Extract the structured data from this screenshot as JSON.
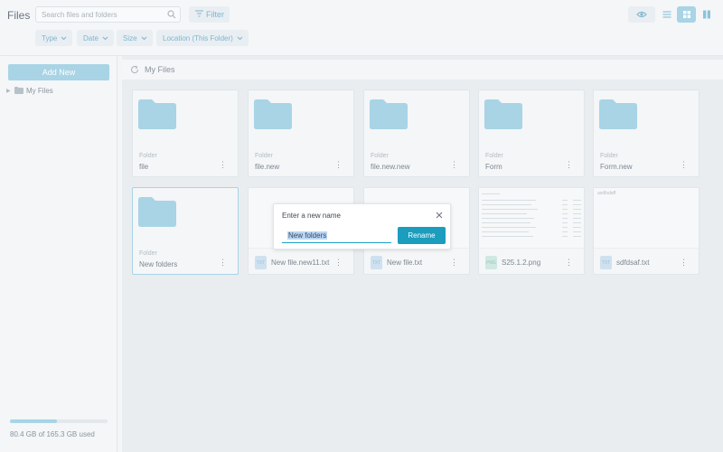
{
  "app": {
    "title": "Files"
  },
  "search": {
    "placeholder": "Search files and folders"
  },
  "toolbar": {
    "filter_label": "Filter"
  },
  "filters": [
    {
      "label": "Type"
    },
    {
      "label": "Date"
    },
    {
      "label": "Size"
    },
    {
      "label": "Location (This Folder)"
    }
  ],
  "view_buttons": [
    {
      "icon": "eye-icon"
    },
    {
      "icon": "list-view-icon"
    },
    {
      "icon": "grid-view-icon",
      "active": true
    },
    {
      "icon": "column-view-icon"
    }
  ],
  "sidebar": {
    "add_new_label": "Add New",
    "tree": [
      {
        "label": "My Files",
        "icon": "folder-icon"
      }
    ],
    "storage": {
      "used_fraction": 0.486,
      "text": "80.4 GB of 165.3 GB used"
    }
  },
  "breadcrumb": {
    "label": "My Files"
  },
  "items": [
    {
      "kind": "folder",
      "type_label": "Folder",
      "name": "file"
    },
    {
      "kind": "folder",
      "type_label": "Folder",
      "name": "file.new"
    },
    {
      "kind": "folder",
      "type_label": "Folder",
      "name": "file.new.new"
    },
    {
      "kind": "folder",
      "type_label": "Folder",
      "name": "Form"
    },
    {
      "kind": "folder",
      "type_label": "Folder",
      "name": "Form.new"
    },
    {
      "kind": "folder",
      "type_label": "Folder",
      "name": "New folders",
      "selected": true
    },
    {
      "kind": "file",
      "badge": "TXT",
      "name": "New file.new11.txt"
    },
    {
      "kind": "file",
      "badge": "TXT",
      "name": "New file.txt"
    },
    {
      "kind": "file",
      "badge": "PNG",
      "name": "S25.1.2.png"
    },
    {
      "kind": "file",
      "badge": "TXT",
      "name": "sdfdsaf.txt",
      "preview_text": "asdfsdaff"
    }
  ],
  "rename_dialog": {
    "title": "Enter a new name",
    "value": "New folders",
    "confirm_label": "Rename"
  },
  "colors": {
    "accent": "#1b9dbd",
    "accent_light": "#a8d4e6",
    "folder": "#a8d4e6"
  }
}
